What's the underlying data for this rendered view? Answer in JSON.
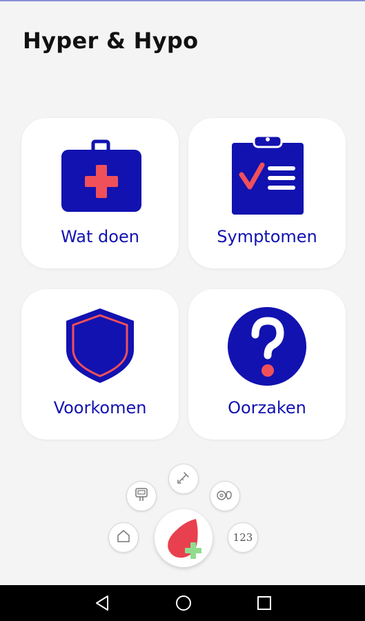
{
  "header": {
    "title": "Hyper & Hypo"
  },
  "cards": [
    {
      "label": "Wat doen",
      "icon": "first-aid-kit-icon"
    },
    {
      "label": "Symptomen",
      "icon": "clipboard-checklist-icon"
    },
    {
      "label": "Voorkomen",
      "icon": "shield-icon"
    },
    {
      "label": "Oorzaken",
      "icon": "question-mark-icon"
    }
  ],
  "fab_menu": {
    "items": [
      {
        "icon": "home-icon"
      },
      {
        "icon": "glucose-meter-icon"
      },
      {
        "icon": "syringe-icon"
      },
      {
        "icon": "nutrition-icon"
      },
      {
        "icon": "numbers-icon",
        "text": "123"
      }
    ],
    "main_icon": "blood-drop-plus-icon"
  },
  "nav": {
    "buttons": [
      "back-icon",
      "home-circle-icon",
      "recents-icon"
    ]
  },
  "colors": {
    "accent": "#1212b0",
    "red": "#f0505a",
    "green": "#8fdc8f",
    "background": "#f4f4f4"
  }
}
